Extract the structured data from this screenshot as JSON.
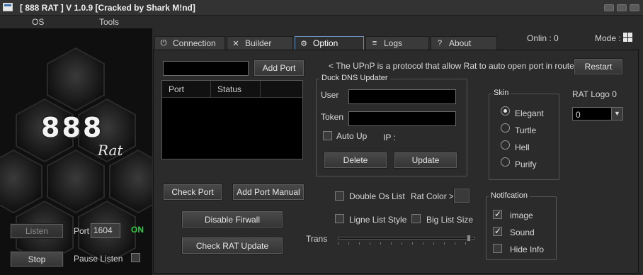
{
  "window": {
    "title": "[ 888 RAT  ] V 1.0.9 [Cracked by Shark M!nd]"
  },
  "menu": [
    "OS",
    "Tools"
  ],
  "logo": {
    "main": "888",
    "sub": "Rat"
  },
  "left": {
    "listen_label": "Listen",
    "port_label": "Port",
    "port_value": "1604",
    "status": "ON",
    "stop_label": "Stop",
    "pause_label": "Pause Listen"
  },
  "status_bar": {
    "online": "Onlin : 0",
    "mode": "Mode :"
  },
  "tabs": [
    {
      "label": "Connection",
      "icon": "plug-icon"
    },
    {
      "label": "Builder",
      "icon": "tools-icon"
    },
    {
      "label": "Option",
      "icon": "gear-icon"
    },
    {
      "label": "Logs",
      "icon": "logs-icon"
    },
    {
      "label": "About",
      "icon": "help-icon"
    }
  ],
  "option": {
    "add_port": "Add Port",
    "upnp_note": "< The UPnP is a protocol that allow Rat to auto open port in router",
    "restart": "Restart",
    "port_table": {
      "columns": [
        "Port",
        "Status"
      ]
    },
    "duck_dns": {
      "title": "Duck DNS Updater",
      "user_label": "User",
      "token_label": "Token",
      "auto_up": "Auto Up",
      "ip_label": "IP :",
      "delete": "Delete",
      "update": "Update"
    },
    "skin": {
      "title": "Skin",
      "options": [
        "Elegant",
        "Turtle",
        "Hell",
        "Purify"
      ],
      "selected": "Elegant"
    },
    "rat_logo": {
      "label": "RAT Logo 0",
      "value": "0"
    },
    "check_port": "Check Port",
    "add_port_manual": "Add Port Manual",
    "disable_firewall": "Disable Firwall",
    "check_update": "Check RAT Update",
    "double_os_list": "Double Os List",
    "rat_color": "Rat Color >",
    "ligne_list_style": "Ligne List Style",
    "big_list_size": "Big List Size",
    "trans": "Trans",
    "notification": {
      "title": "Notifcation",
      "items": [
        {
          "label": "image",
          "checked": true
        },
        {
          "label": "Sound",
          "checked": true
        },
        {
          "label": "Hide Info",
          "checked": false
        }
      ]
    }
  },
  "colors": {
    "accent_on": "#2ecc40",
    "tab_active_border": "#6a8fb8"
  }
}
